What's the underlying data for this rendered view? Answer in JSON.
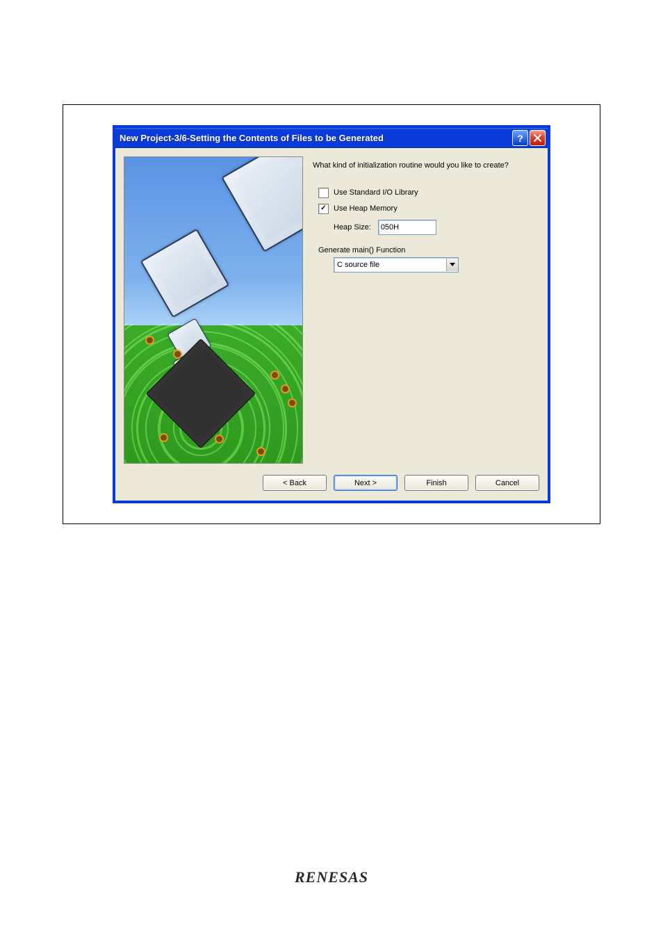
{
  "dialog": {
    "title": "New Project-3/6-Setting the Contents of Files to be Generated",
    "question": "What kind of initialization routine would you like to create?",
    "checkboxes": {
      "io": {
        "label": "Use Standard I/O Library",
        "checked": false
      },
      "heap": {
        "label": "Use Heap Memory",
        "checked": true
      }
    },
    "heap_size_label": "Heap Size:",
    "heap_size_value": "050H",
    "generate_label": "Generate main() Function",
    "generate_select": "C source file"
  },
  "buttons": {
    "back": "< Back",
    "next": "Next >",
    "finish": "Finish",
    "cancel": "Cancel"
  },
  "footer": {
    "logo": "RENESAS"
  }
}
